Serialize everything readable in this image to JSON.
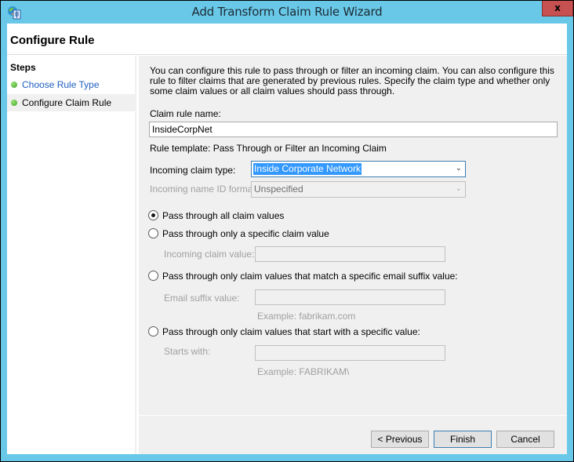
{
  "window": {
    "title": "Add Transform Claim Rule Wizard",
    "close_label": "x",
    "app_icon": "adfs-management-icon"
  },
  "header": {
    "title": "Configure Rule"
  },
  "steps": {
    "title": "Steps",
    "items": [
      {
        "label": "Choose Rule Type",
        "state": "completed-link"
      },
      {
        "label": "Configure Claim Rule",
        "state": "current"
      }
    ]
  },
  "main": {
    "description": "You can configure this rule to pass through or filter an incoming claim. You can also configure this rule to filter claims that are generated by previous rules. Specify the claim type and whether only some claim values or all claim values should pass through.",
    "claim_rule_name_label": "Claim rule name:",
    "claim_rule_name_value": "InsideCorpNet",
    "rule_template": "Rule template: Pass Through or Filter an Incoming Claim",
    "incoming_claim_type_label": "Incoming claim type:",
    "incoming_claim_type_value": "Inside Corporate Network",
    "incoming_name_id_format_label": "Incoming name ID format:",
    "incoming_name_id_format_value": "Unspecified",
    "options": [
      {
        "label": "Pass through all claim values",
        "selected": true
      },
      {
        "label": "Pass through only a specific claim value",
        "selected": false
      },
      {
        "label": "Pass through only claim values that match a specific email suffix value:",
        "selected": false
      },
      {
        "label": "Pass through only claim values that start with a specific value:",
        "selected": false
      }
    ],
    "incoming_claim_value_label": "Incoming claim value:",
    "incoming_claim_value": "",
    "email_suffix_label": "Email suffix value:",
    "email_suffix_value": "",
    "email_suffix_example": "Example: fabrikam.com",
    "starts_with_label": "Starts with:",
    "starts_with_value": "",
    "starts_with_example": "Example: FABRIKAM\\"
  },
  "buttons": {
    "previous": "< Previous",
    "finish": "Finish",
    "cancel": "Cancel"
  }
}
